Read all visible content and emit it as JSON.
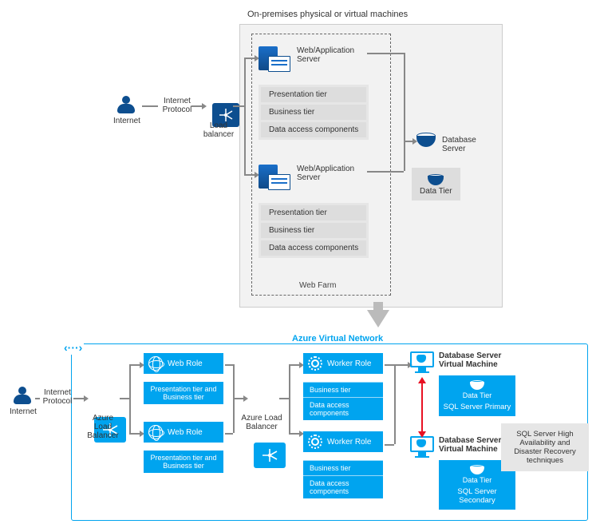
{
  "onprem": {
    "title": "On-premises physical or virtual machines",
    "internet": "Internet",
    "internet_protocol": "Internet Protocol",
    "load_balancer": "Load balancer",
    "webfarm": "Web Farm",
    "app_servers": [
      {
        "label": "Web/Application Server",
        "tiers": {
          "presentation": "Presentation tier",
          "business": "Business tier",
          "data_access": "Data access components"
        }
      },
      {
        "label": "Web/Application Server",
        "tiers": {
          "presentation": "Presentation tier",
          "business": "Business tier",
          "data_access": "Data access components"
        }
      }
    ],
    "db_server": "Database Server",
    "data_tier": "Data Tier"
  },
  "azure": {
    "title": "Azure Virtual Network",
    "internet": "Internet",
    "internet_protocol": "Internet Protocol",
    "load_balancer_1": "Azure Load Balancer",
    "load_balancer_2": "Azure Load Balancer",
    "web_roles": [
      {
        "label": "Web Role",
        "tier": "Presentation tier and Business tier"
      },
      {
        "label": "Web Role",
        "tier": "Presentation tier and Business tier"
      }
    ],
    "worker_roles": [
      {
        "label": "Worker Role",
        "tiers": {
          "business": "Business tier",
          "data_access": "Data access components"
        }
      },
      {
        "label": "Worker Role",
        "tiers": {
          "business": "Business tier",
          "data_access": "Data access components"
        }
      }
    ],
    "db_vms": [
      {
        "label": "Database Server Virtual Machine",
        "server": "SQL Server Primary",
        "data_tier": "Data Tier"
      },
      {
        "label": "Database Server Virtual Machine",
        "server": "SQL Server Secondary",
        "data_tier": "Data Tier"
      }
    ],
    "sql_note": "SQL Server High Availability and Disaster Recovery techniques"
  }
}
